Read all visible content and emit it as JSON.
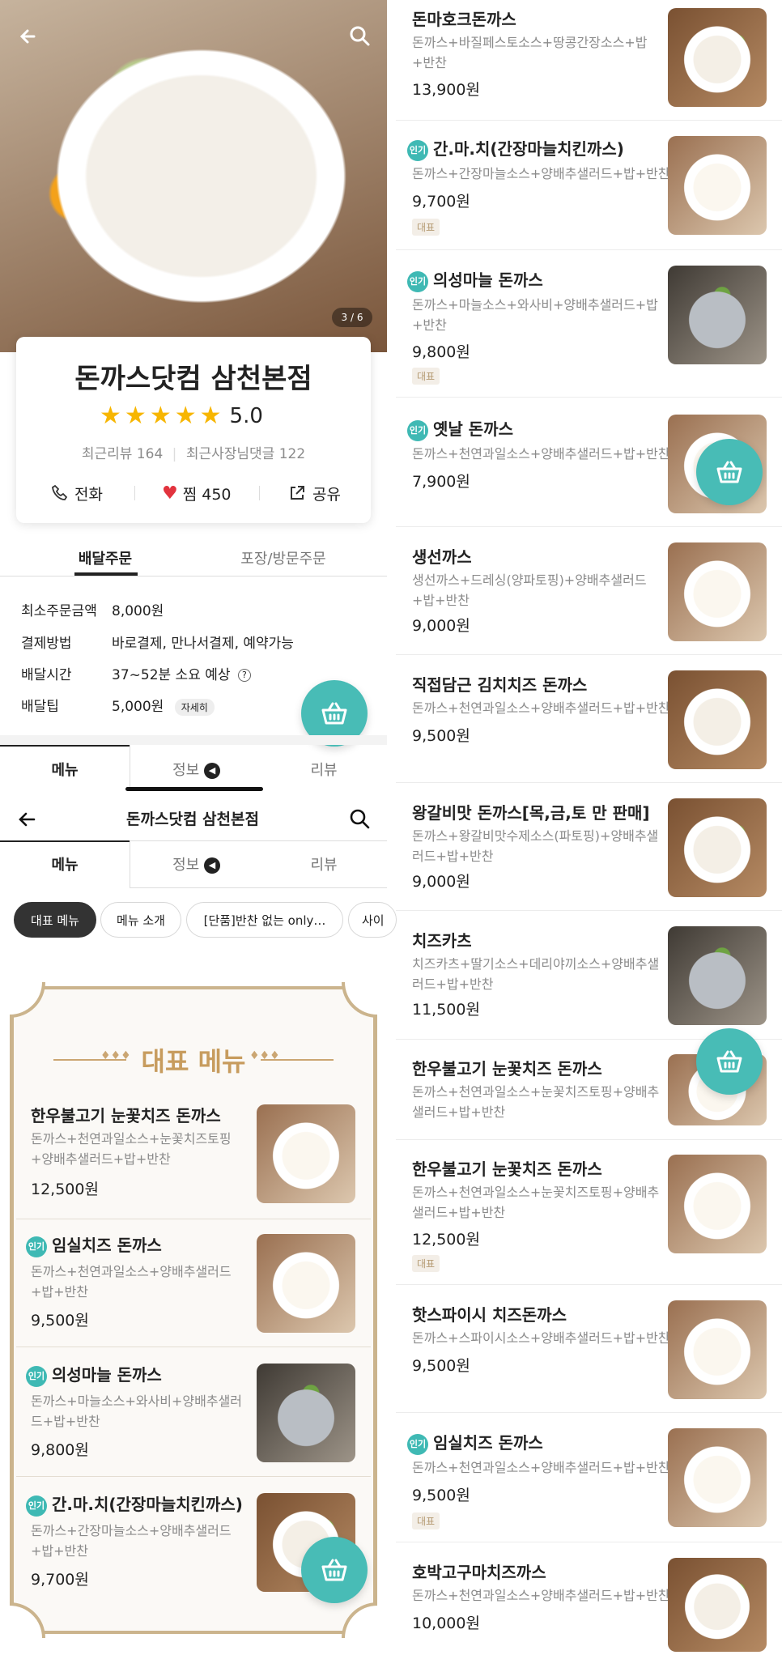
{
  "hero": {
    "counter": "3 / 6"
  },
  "store": {
    "name": "돈까스닷컴 삼천본점",
    "rating": "5.0",
    "recent_reviews": "최근리뷰 164",
    "owner_replies": "최근사장님댓글 122",
    "call_label": "전화",
    "like_label": "찜 450",
    "share_label": "공유"
  },
  "order_tabs": {
    "delivery": "배달주문",
    "pickup": "포장/방문주문"
  },
  "info": [
    {
      "label": "최소주문금액",
      "value": "8,000원"
    },
    {
      "label": "결제방법",
      "value": "바로결제, 만나서결제, 예약가능"
    },
    {
      "label": "배달시간",
      "value": "37~52분 소요 예상"
    },
    {
      "label": "배달팁",
      "value": "5,000원",
      "badge": "자세히"
    }
  ],
  "main_tabs": {
    "menu": "메뉴",
    "info": "정보",
    "review": "리뷰"
  },
  "sticky_header": {
    "title": "돈까스닷컴 삼천본점"
  },
  "chips": [
    "대표 메뉴",
    "메뉴 소개",
    "[단품]반찬 없는 only…",
    "사이"
  ],
  "featured": {
    "heading": "대표 메뉴",
    "hot_label": "인기",
    "items": [
      {
        "name": "한우불고기 눈꽃치즈 돈까스",
        "desc": "돈까스+천연과일소스+눈꽃치즈토핑+양배추샐러드+밥+반찬",
        "price": "12,500원"
      },
      {
        "name": "임실치즈 돈까스",
        "desc": "돈까스+천연과일소스+양배추샐러드+밥+반찬",
        "price": "9,500원"
      },
      {
        "name": "의성마늘 돈까스",
        "desc": "돈까스+마늘소스+와사비+양배추샐러드+밥+반찬",
        "price": "9,800원"
      },
      {
        "name": "간.마.치(간장마늘치킨까스)",
        "desc": "돈까스+간장마늘소스+양배추샐러드+밥+반찬",
        "price": "9,700원"
      }
    ]
  },
  "menu_list": {
    "hot_label": "인기",
    "rep_label": "대표",
    "items": [
      {
        "name": "돈마호크돈까스",
        "desc": "돈까스+바질페스토소스+땅콩간장소스+밥+반찬",
        "price": "13,900원"
      },
      {
        "name": "간.마.치(간장마늘치킨까스)",
        "desc": "돈까스+간장마늘소스+양배추샐러드+밥+반찬",
        "price": "9,700원"
      },
      {
        "name": "의성마늘 돈까스",
        "desc": "돈까스+마늘소스+와사비+양배추샐러드+밥+반찬",
        "price": "9,800원"
      },
      {
        "name": "옛날 돈까스",
        "desc": "돈까스+천연과일소스+양배추샐러드+밥+반찬",
        "price": "7,900원"
      },
      {
        "name": "생선까스",
        "desc": "생선까스+드레싱(양파토핑)+양배추샐러드+밥+반찬",
        "price": "9,000원"
      },
      {
        "name": "직접담근 김치치즈 돈까스",
        "desc": "돈까스+천연과일소스+양배추샐러드+밥+반찬",
        "price": "9,500원"
      },
      {
        "name": "왕갈비맛 돈까스[목,금,토 만 판매]",
        "desc": "돈까스+왕갈비맛수제소스(파토핑)+양배추샐러드+밥+반찬",
        "price": "9,000원"
      },
      {
        "name": "치즈카츠",
        "desc": "치즈카츠+딸기소스+데리야끼소스+양배추샐러드+밥+반찬",
        "price": "11,500원"
      },
      {
        "name": "한우불고기 눈꽃치즈 돈까스",
        "desc": "돈까스+천연과일소스+눈꽃치즈토핑+양배추샐러드+밥+반찬",
        "price": ""
      },
      {
        "name": "한우불고기 눈꽃치즈 돈까스",
        "desc": "돈까스+천연과일소스+눈꽃치즈토핑+양배추샐러드+밥+반찬",
        "price": "12,500원"
      },
      {
        "name": "핫스파이시 치즈돈까스",
        "desc": "돈까스+스파이시소스+양배추샐러드+밥+반찬",
        "price": "9,500원"
      },
      {
        "name": "임실치즈 돈까스",
        "desc": "돈까스+천연과일소스+양배추샐러드+밥+반찬",
        "price": "9,500원"
      },
      {
        "name": "호박고구마치즈까스",
        "desc": "돈까스+천연과일소스+양배추샐러드+밥+반찬",
        "price": "10,000원"
      }
    ]
  }
}
